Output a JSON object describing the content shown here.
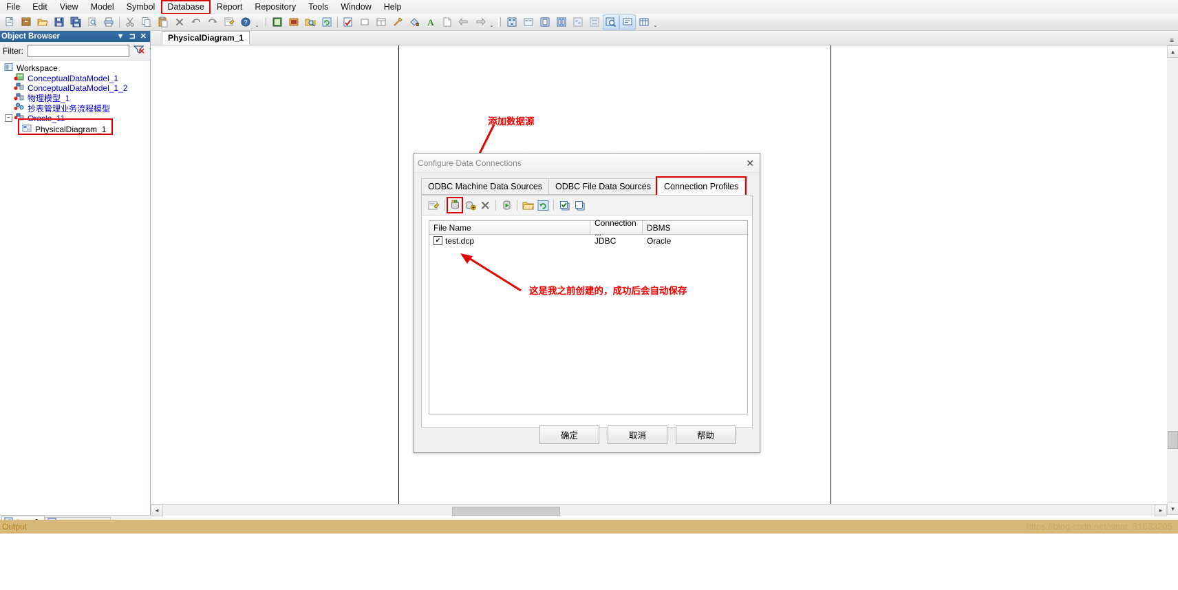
{
  "menubar": {
    "items": [
      {
        "label": "File",
        "boxed": false
      },
      {
        "label": "Edit",
        "boxed": false
      },
      {
        "label": "View",
        "boxed": false
      },
      {
        "label": "Model",
        "boxed": false
      },
      {
        "label": "Symbol",
        "boxed": false
      },
      {
        "label": "Database",
        "boxed": true
      },
      {
        "label": "Report",
        "boxed": false
      },
      {
        "label": "Repository",
        "boxed": false
      },
      {
        "label": "Tools",
        "boxed": false
      },
      {
        "label": "Window",
        "boxed": false
      },
      {
        "label": "Help",
        "boxed": false
      }
    ]
  },
  "toolbar": {
    "icons": [
      "new-document-icon",
      "new-model-icon",
      "open-folder-icon",
      "save-icon",
      "save-all-icon",
      "print-preview-icon",
      "print-icon",
      "cut-icon",
      "copy-icon",
      "paste-icon",
      "delete-icon",
      "undo-icon",
      "redo-icon",
      "properties-icon",
      "help-icon",
      "new-package-icon",
      "import-icon",
      "find-object-icon",
      "refresh-icon",
      "check-model-icon",
      "rectangle-icon",
      "text-box-icon",
      "line-icon",
      "fill-color-icon",
      "font-color-icon",
      "note-icon",
      "align-left-icon",
      "align-right-icon",
      "dependency-matrix-icon",
      "object-list-icon",
      "page-icon",
      "columns-icon",
      "diagram1-icon",
      "diagram2-icon",
      "zoom-icon",
      "comment-icon",
      "grid-icon"
    ]
  },
  "object_browser": {
    "title": "Object Browser",
    "title_buttons": [
      "chevron-down-icon",
      "pin-icon",
      "close-icon"
    ],
    "filter_label": "Filter:",
    "filter_value": "",
    "filter_buttons": [
      "clear-filter-icon",
      "refresh-icon"
    ],
    "tree": {
      "root": "Workspace",
      "items": [
        {
          "label": "ConceptualDataModel_1",
          "icon": "cdm-icon",
          "indent": 1,
          "selected": false
        },
        {
          "label": "ConceptualDataModel_1_2",
          "icon": "cdm-icon",
          "indent": 1,
          "selected": false
        },
        {
          "label": "物理模型_1",
          "icon": "pdm-icon",
          "indent": 1,
          "selected": false
        },
        {
          "label": "抄表管理业务流程模型",
          "icon": "bpm-icon",
          "indent": 1,
          "selected": false
        },
        {
          "label": "Oracle_11",
          "icon": "db-icon",
          "indent": 1,
          "selected": false,
          "expanded": true
        },
        {
          "label": "PhysicalDiagram_1",
          "icon": "diagram-icon",
          "indent": 2,
          "selected": true
        }
      ]
    },
    "tabs": [
      {
        "label": "Local",
        "icon": "local-icon",
        "active": true
      },
      {
        "label": "Repository",
        "icon": "repository-icon",
        "active": false
      }
    ]
  },
  "diagram_area": {
    "tab_label": "PhysicalDiagram_1",
    "tabbar_menu_icon": "overflow-menu-icon"
  },
  "dialog": {
    "title": "Configure Data Connections",
    "close_icon": "close-icon",
    "tabs": [
      {
        "label": "ODBC Machine Data Sources",
        "active": false,
        "boxed": false
      },
      {
        "label": "ODBC File Data Sources",
        "active": false,
        "boxed": false
      },
      {
        "label": "Connection Profiles",
        "active": true,
        "boxed": true
      }
    ],
    "toolbar_icons": [
      {
        "name": "configure-icon",
        "boxed": false
      },
      {
        "name": "add-data-source-icon",
        "boxed": true
      },
      {
        "name": "add-profile-icon",
        "boxed": false
      },
      {
        "name": "delete-icon",
        "boxed": false
      },
      {
        "name": "connect-icon",
        "boxed": false
      },
      {
        "name": "open-folder-icon",
        "boxed": false
      },
      {
        "name": "refresh-icon",
        "boxed": false
      },
      {
        "name": "select-all-icon",
        "boxed": false
      },
      {
        "name": "deselect-all-icon",
        "boxed": false
      }
    ],
    "grid": {
      "columns": [
        "File Name",
        "Connection ...",
        "DBMS"
      ],
      "rows": [
        {
          "checked": true,
          "file_name": "test.dcp",
          "connection": "JDBC",
          "dbms": "Oracle"
        }
      ]
    },
    "buttons": [
      {
        "label": "确定",
        "name": "ok-button"
      },
      {
        "label": "取消",
        "name": "cancel-button"
      },
      {
        "label": "帮助",
        "name": "help-button"
      }
    ]
  },
  "annotations": [
    {
      "text": "添加数据源",
      "name": "annotation-add-data-source"
    },
    {
      "text": "这是我之前创建的，成功后会自动保存",
      "name": "annotation-saved-profile"
    }
  ],
  "statusbar": {
    "output_label": "Output",
    "watermark": "https://blog.csdn.net/sinat_31633205"
  },
  "colors": {
    "accent_red": "#e00000",
    "title_blue": "#2a5f96",
    "tree_link": "#0000cd"
  }
}
